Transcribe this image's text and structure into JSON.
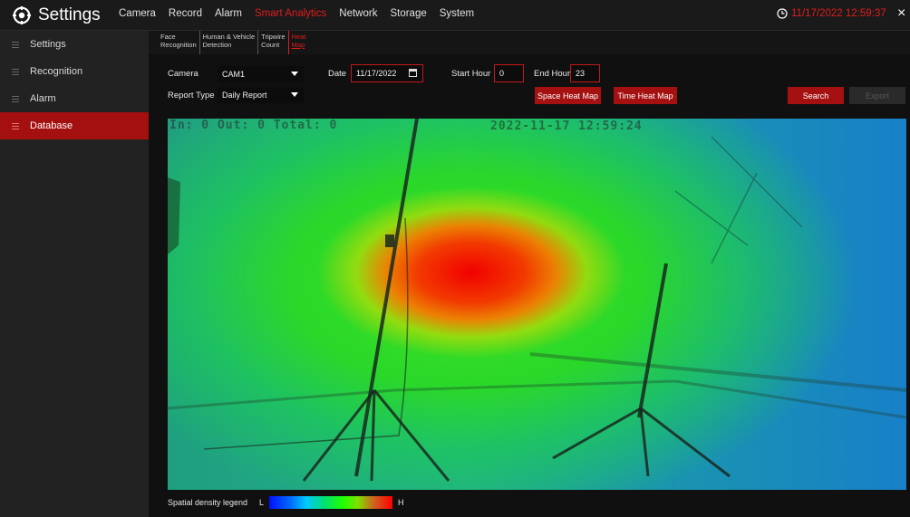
{
  "header": {
    "title": "Settings",
    "nav": [
      {
        "label": "Camera",
        "active": false
      },
      {
        "label": "Record",
        "active": false
      },
      {
        "label": "Alarm",
        "active": false
      },
      {
        "label": "Smart Analytics",
        "active": true
      },
      {
        "label": "Network",
        "active": false
      },
      {
        "label": "Storage",
        "active": false
      },
      {
        "label": "System",
        "active": false
      }
    ],
    "datetime": "11/17/2022 12:59:37",
    "close_glyph": "×"
  },
  "sidebar": {
    "items": [
      {
        "label": "Settings",
        "active": false
      },
      {
        "label": "Recognition",
        "active": false
      },
      {
        "label": "Alarm",
        "active": false
      },
      {
        "label": "Database",
        "active": true
      }
    ]
  },
  "subtabs": [
    {
      "line1": "Face",
      "line2": "Recognition",
      "active": false
    },
    {
      "line1": "Human & Vehicle",
      "line2": "Detection",
      "active": false
    },
    {
      "line1": "Tripwire",
      "line2": "Count",
      "active": false
    },
    {
      "line1": "Heat",
      "line2": "Map",
      "active": true
    }
  ],
  "filters": {
    "camera_label": "Camera",
    "camera_value": "CAM1",
    "date_label": "Date",
    "date_value": "11/17/2022",
    "start_hour_label": "Start Hour",
    "start_hour_value": "0",
    "end_hour_label": "End Hour",
    "end_hour_value": "23",
    "report_type_label": "Report Type",
    "report_type_value": "Daily Report"
  },
  "buttons": {
    "space_heat_map": "Space Heat Map",
    "time_heat_map": "Time Heat Map",
    "search": "Search",
    "export": "Export"
  },
  "heatmap": {
    "counter_text": "In:  0  Out:  0  Total:  0",
    "timestamp": "2022-11-17 12:59:24"
  },
  "legend": {
    "label": "Spatial density legend",
    "low": "L",
    "high": "H"
  },
  "colors": {
    "accent": "#a51010",
    "active_text": "#e01c1c"
  }
}
